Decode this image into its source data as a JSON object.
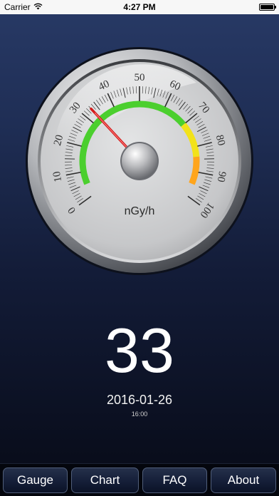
{
  "status_bar": {
    "carrier": "Carrier",
    "time": "4:27 PM",
    "wifi_icon": "wifi-icon",
    "battery_icon": "battery-icon"
  },
  "gauge": {
    "unit": "nGy/h",
    "min": 0,
    "max": 100,
    "value": 33,
    "tick_labels": [
      "0",
      "10",
      "20",
      "30",
      "40",
      "50",
      "60",
      "70",
      "80",
      "90",
      "100"
    ],
    "zones": [
      {
        "from": 5,
        "to": 70,
        "color": "#4bcf2e"
      },
      {
        "from": 70,
        "to": 84,
        "color": "#f2e21a"
      },
      {
        "from": 84,
        "to": 95,
        "color": "#ffa51c"
      }
    ],
    "needle_color": "#d31a1a"
  },
  "reading": {
    "value": "33",
    "date": "2016-01-26",
    "time": "16:00"
  },
  "tabs": [
    {
      "label": "Gauge"
    },
    {
      "label": "Chart"
    },
    {
      "label": "FAQ"
    },
    {
      "label": "About"
    }
  ]
}
